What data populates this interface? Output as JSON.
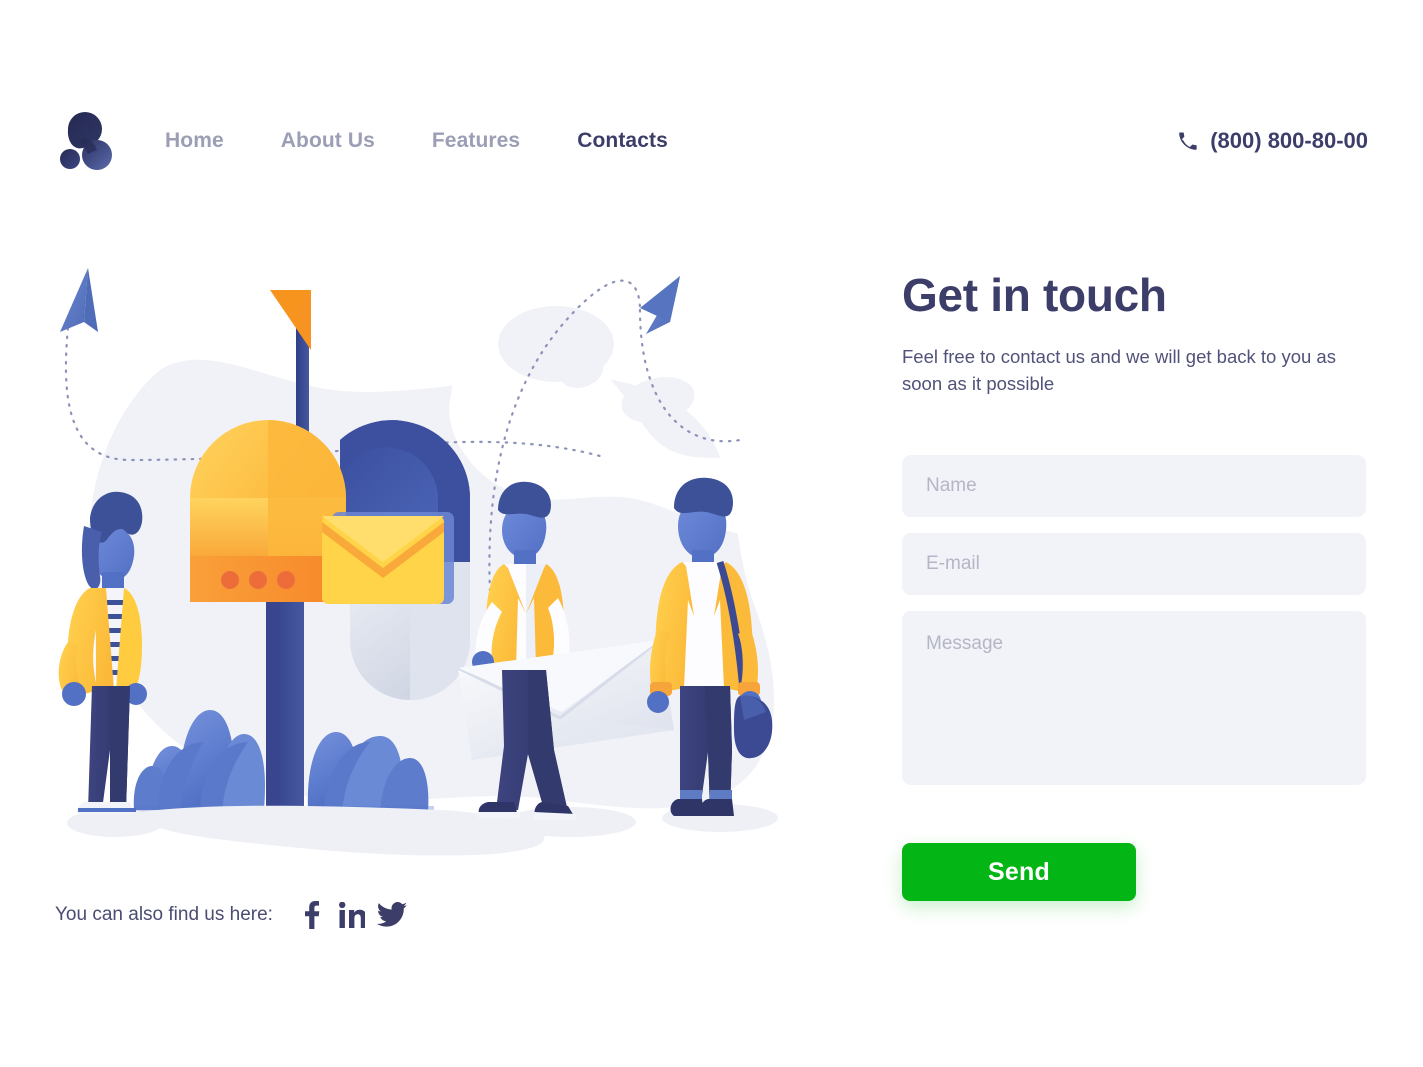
{
  "header": {
    "logo_icon": "three-circle-logo",
    "nav": [
      {
        "label": "Home",
        "active": false
      },
      {
        "label": "About Us",
        "active": false
      },
      {
        "label": "Features",
        "active": false
      },
      {
        "label": "Contacts",
        "active": true
      }
    ],
    "phone_icon": "phone-icon",
    "phone": "(800) 800-80-00"
  },
  "illustration": {
    "alt": "mailbox-with-people-illustration",
    "elements": [
      "background-blob",
      "paper-airplane-left",
      "paper-airplane-right",
      "dotted-trail-left",
      "dotted-trail-right",
      "mailbox",
      "mailbox-flag",
      "envelope-in-mailbox",
      "bushes",
      "woman-figure",
      "man-with-envelope-figure",
      "man-with-bag-figure",
      "ground-shadow"
    ],
    "colors": {
      "blob": "#f1f2f7",
      "mailbox_yellow": "#fcc13f",
      "mailbox_yellow_light": "#ffd15c",
      "mailbox_orange": "#f99c2e",
      "mailbox_navy": "#3b4d9e",
      "mailbox_navy_light": "#4a66bd",
      "flag_orange": "#f7941e",
      "bush_blue": "#6a8bd6",
      "bush_blue_dark": "#4f6fc4",
      "skin_blue": "#5d7ad1",
      "hair_navy": "#3d5199",
      "jacket_yellow": "#ffc93c",
      "pants_navy": "#3a4178",
      "envelope_white": "#eef0f6",
      "airplane_blue": "#5e7cc4",
      "shadow": "#eef0f6"
    }
  },
  "social": {
    "label": "You can also find us here:",
    "items": [
      {
        "name": "facebook-icon",
        "label": "Facebook"
      },
      {
        "name": "linkedin-icon",
        "label": "LinkedIn"
      },
      {
        "name": "twitter-icon",
        "label": "Twitter"
      }
    ]
  },
  "form": {
    "title": "Get in touch",
    "subtitle": "Feel free to contact us and we will get back to you as soon as it possible",
    "fields": {
      "name": {
        "placeholder": "Name",
        "value": ""
      },
      "email": {
        "placeholder": "E-mail",
        "value": ""
      },
      "message": {
        "placeholder": "Message",
        "value": ""
      }
    },
    "submit_label": "Send",
    "submit_color": "#03b615"
  },
  "theme": {
    "text_dark": "#3c3e69",
    "text_muted": "#9b9eb5",
    "field_bg": "#f2f3f8",
    "placeholder": "#b4b6c6",
    "accent_green": "#03b615",
    "page_bg": "#ffffff"
  }
}
